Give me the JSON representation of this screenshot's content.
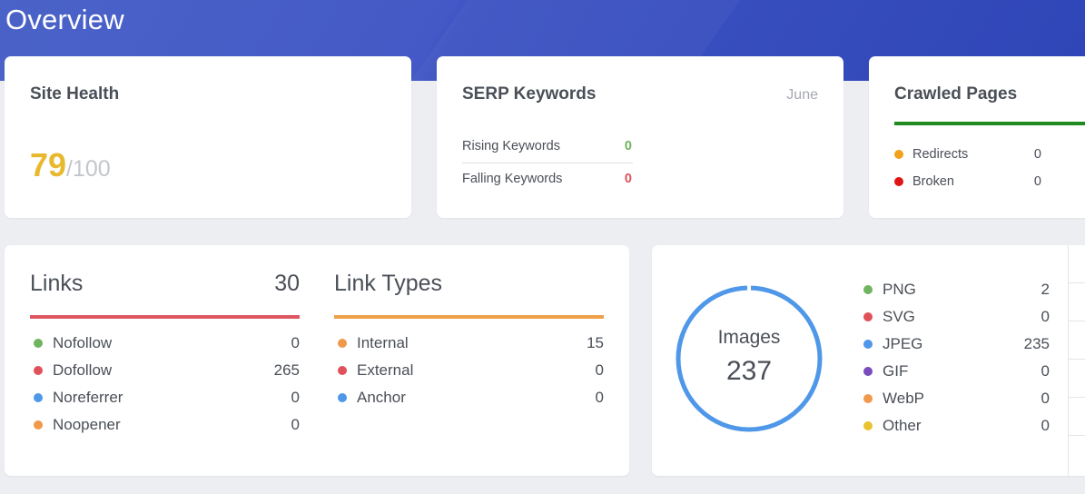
{
  "header": {
    "title": "Overview"
  },
  "site_health": {
    "title": "Site Health",
    "score": "79",
    "max": "/100"
  },
  "serp": {
    "title": "SERP Keywords",
    "period": "June",
    "rows": [
      {
        "label": "Rising Keywords",
        "value": "0"
      },
      {
        "label": "Falling Keywords",
        "value": "0"
      }
    ]
  },
  "crawled": {
    "title": "Crawled Pages",
    "rows": [
      {
        "label": "Redirects",
        "value": "0"
      },
      {
        "label": "Broken",
        "value": "0"
      }
    ]
  },
  "links": {
    "title": "Links",
    "total": "30",
    "rows": [
      {
        "label": "Nofollow",
        "value": "0"
      },
      {
        "label": "Dofollow",
        "value": "265"
      },
      {
        "label": "Noreferrer",
        "value": "0"
      },
      {
        "label": "Noopener",
        "value": "0"
      }
    ]
  },
  "link_types": {
    "title": "Link Types",
    "rows": [
      {
        "label": "Internal",
        "value": "15"
      },
      {
        "label": "External",
        "value": "0"
      },
      {
        "label": "Anchor",
        "value": "0"
      }
    ]
  },
  "images": {
    "label": "Images",
    "total": "237",
    "rows": [
      {
        "label": "PNG",
        "value": "2"
      },
      {
        "label": "SVG",
        "value": "0"
      },
      {
        "label": "JPEG",
        "value": "235"
      },
      {
        "label": "GIF",
        "value": "0"
      },
      {
        "label": "WebP",
        "value": "0"
      },
      {
        "label": "Other",
        "value": "0"
      }
    ]
  },
  "colors": {
    "score": "#e8b92f",
    "green": "#6fb45e",
    "red": "#e0515a",
    "blue": "#4f97e8",
    "orange": "#f0994a",
    "purple": "#7a4bbd",
    "yellow": "#e8c32f",
    "links_bar": "#dd5660",
    "link_types_bar": "#eea048",
    "crawled_bar": "#1f8a1f",
    "crawled_redirect": "#f0a21a",
    "crawled_broken": "#e21313",
    "ring": "#4f97e8"
  }
}
